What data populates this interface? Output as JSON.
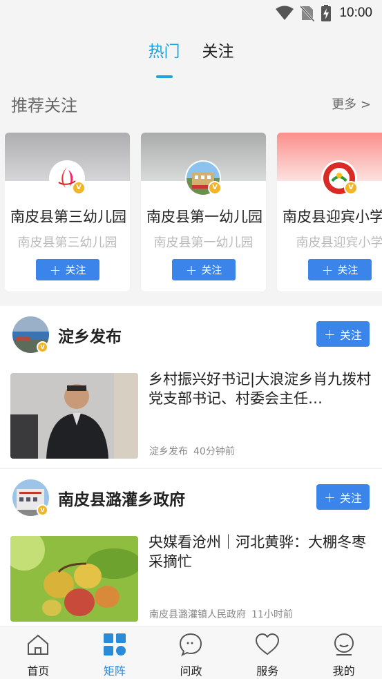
{
  "status": {
    "time": "10:00"
  },
  "tabs": [
    {
      "label": "热门",
      "active": true
    },
    {
      "label": "关注",
      "active": false
    }
  ],
  "recommend": {
    "title": "推荐关注",
    "more": "更多 >",
    "follow_label": "关注",
    "cards": [
      {
        "name": "南皮县第三幼儿园",
        "subtitle": "南皮县第三幼儿园",
        "banner": "#b9b9bb"
      },
      {
        "name": "南皮县第一幼儿园",
        "subtitle": "南皮县第一幼儿园",
        "banner": "#b6b9b8"
      },
      {
        "name": "南皮县迎宾小学",
        "subtitle": "南皮县迎宾小学",
        "banner": "#fb9a96"
      }
    ]
  },
  "feed": {
    "follow_label": "关注",
    "badge": "V",
    "items": [
      {
        "account": "淀乡发布",
        "title": "乡村振兴好书记|大浪淀乡肖九拨村党支部书记、村委会主任…",
        "source": "淀乡发布",
        "time": "40分钟前"
      },
      {
        "account": "南皮县潞灌乡政府",
        "title": "央媒看沧州｜河北黄骅：大棚冬枣采摘忙",
        "source": "南皮县潞灌镇人民政府",
        "time": "11小时前"
      }
    ]
  },
  "bottom_nav": [
    {
      "label": "首页",
      "icon": "home-icon",
      "active": false
    },
    {
      "label": "矩阵",
      "icon": "grid-icon",
      "active": true
    },
    {
      "label": "问政",
      "icon": "chat-icon",
      "active": false
    },
    {
      "label": "服务",
      "icon": "heart-icon",
      "active": false
    },
    {
      "label": "我的",
      "icon": "user-icon",
      "active": false
    }
  ],
  "colors": {
    "accent": "#1ea5e0",
    "button": "#3b84ea",
    "badge": "#f1b526"
  }
}
